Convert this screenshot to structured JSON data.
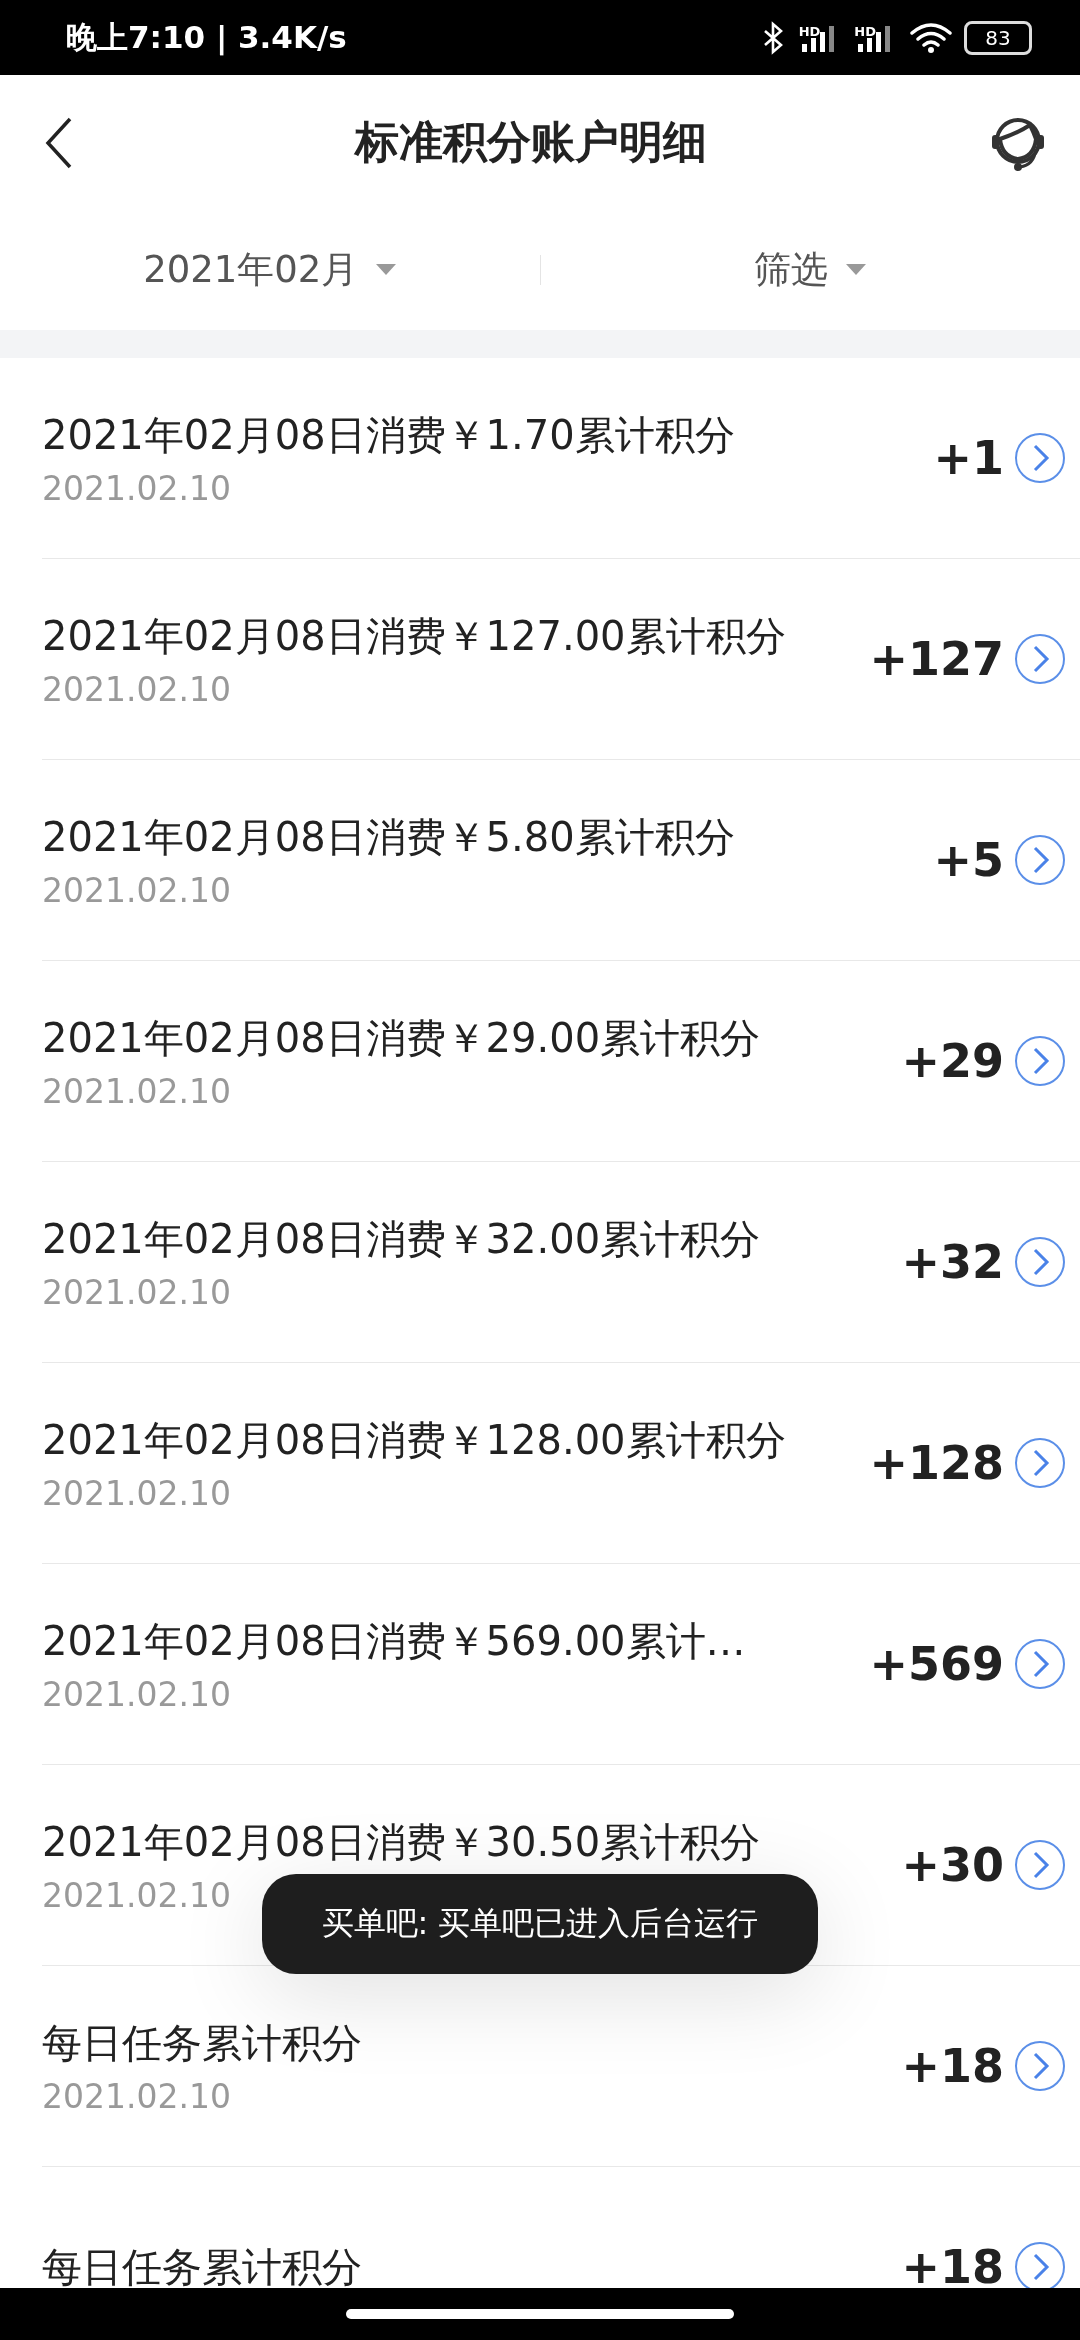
{
  "status_bar": {
    "time": "晚上7:10 | 3.4K/s",
    "signal_labels": [
      "HD",
      "HD"
    ],
    "battery": "83"
  },
  "header": {
    "title": "标准积分账户明细"
  },
  "filters": [
    {
      "label": "2021年02月"
    },
    {
      "label": "筛选"
    }
  ],
  "records": [
    {
      "title": "2021年02月08日消费￥1.70累计积分",
      "date": "2021.02.10",
      "points": "+1"
    },
    {
      "title": "2021年02月08日消费￥127.00累计积分",
      "date": "2021.02.10",
      "points": "+127"
    },
    {
      "title": "2021年02月08日消费￥5.80累计积分",
      "date": "2021.02.10",
      "points": "+5"
    },
    {
      "title": "2021年02月08日消费￥29.00累计积分",
      "date": "2021.02.10",
      "points": "+29"
    },
    {
      "title": "2021年02月08日消费￥32.00累计积分",
      "date": "2021.02.10",
      "points": "+32"
    },
    {
      "title": "2021年02月08日消费￥128.00累计积分",
      "date": "2021.02.10",
      "points": "+128"
    },
    {
      "title": "2021年02月08日消费￥569.00累计…",
      "date": "2021.02.10",
      "points": "+569"
    },
    {
      "title": "2021年02月08日消费￥30.50累计积分",
      "date": "2021.02.10",
      "points": "+30"
    },
    {
      "title": "每日任务累计积分",
      "date": "2021.02.10",
      "points": "+18"
    },
    {
      "title": "每日任务累计积分",
      "points": "+18"
    }
  ],
  "toast": {
    "text": "买单吧: 买单吧已进入后台运行"
  }
}
